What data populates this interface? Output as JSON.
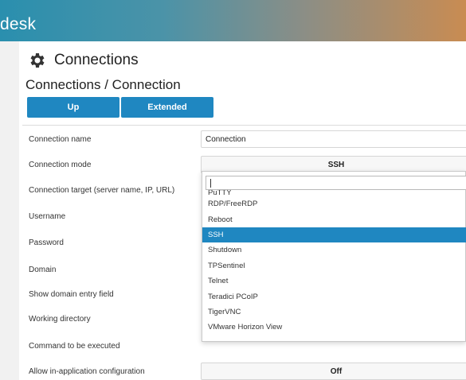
{
  "app": {
    "brand": "desk"
  },
  "page": {
    "title": "Connections",
    "subtitle": "Connections / Connection"
  },
  "toolbar": {
    "up_label": "Up",
    "extended_label": "Extended"
  },
  "form": {
    "rows": [
      {
        "label": "Connection name",
        "value": "Connection"
      },
      {
        "label": "Connection mode",
        "value": "SSH"
      },
      {
        "label": "Connection target (server name, IP, URL)"
      },
      {
        "label": "Username"
      },
      {
        "label": "Password"
      },
      {
        "label": "Domain"
      },
      {
        "label": "Show domain entry field"
      },
      {
        "label": "Working directory"
      },
      {
        "label": "Command to be executed"
      },
      {
        "label": "Allow in-application configuration",
        "value": "Off"
      }
    ]
  },
  "dropdown": {
    "search_value": "",
    "items": [
      "PuTTY",
      "RDP/FreeRDP",
      "Reboot",
      "SSH",
      "Shutdown",
      "TPSentinel",
      "Telnet",
      "Teradici PCoIP",
      "TigerVNC",
      "VMware Horizon View"
    ],
    "selected": "SSH"
  },
  "colors": {
    "accent": "#1f87c1",
    "banner_start": "#2a8fae",
    "banner_end": "#c98c52"
  }
}
